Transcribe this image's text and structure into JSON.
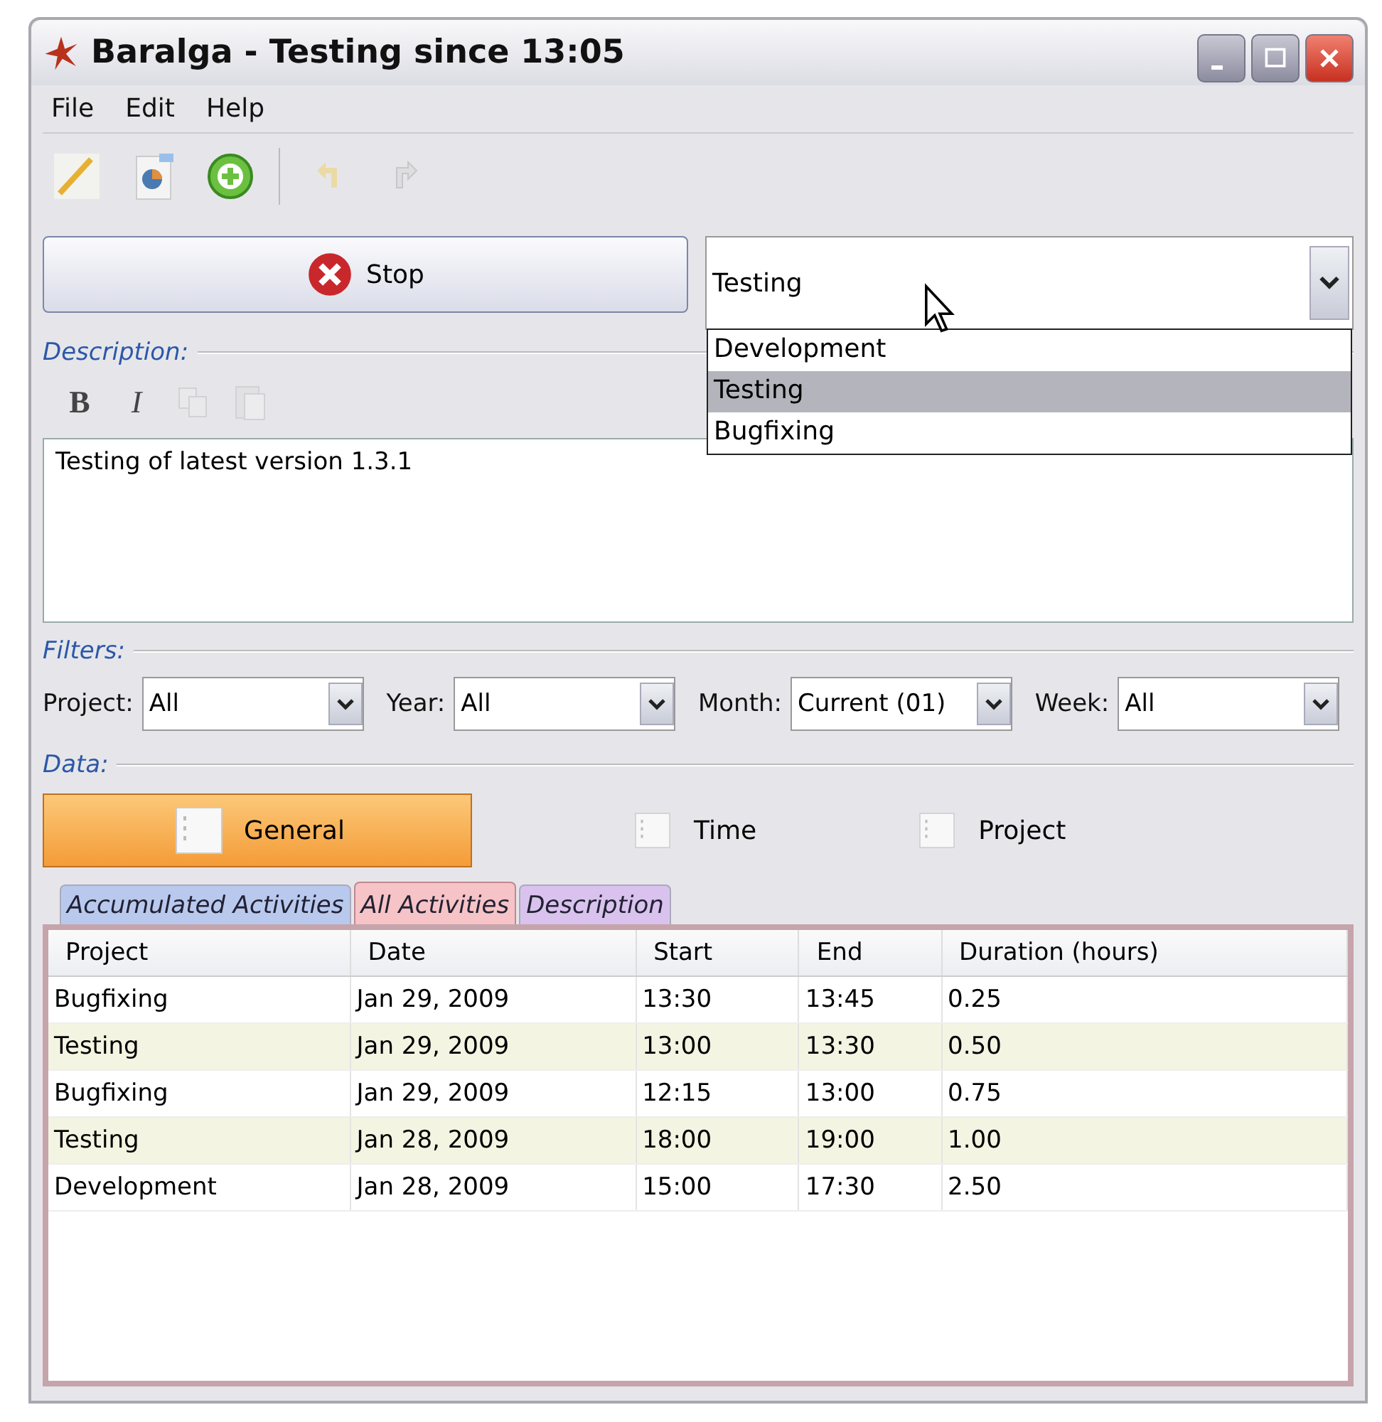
{
  "window": {
    "title": "Baralga - Testing since 13:05"
  },
  "menu": [
    "File",
    "Edit",
    "Help"
  ],
  "toolbar": [
    {
      "kind": "pencil",
      "disabled": false
    },
    {
      "kind": "report",
      "disabled": false
    },
    {
      "kind": "add",
      "disabled": false
    },
    {
      "kind": "undo",
      "disabled": true
    },
    {
      "kind": "redo",
      "disabled": true
    }
  ],
  "stop_button": {
    "label": "Stop"
  },
  "project_select": {
    "value": "Testing",
    "options": [
      {
        "label": "Development",
        "selected": false
      },
      {
        "label": "Testing",
        "selected": true
      },
      {
        "label": "Bugfixing",
        "selected": false
      }
    ]
  },
  "description": {
    "label": "Description:",
    "format_buttons": [
      {
        "kind": "bold",
        "label": "B",
        "disabled": false
      },
      {
        "kind": "italic",
        "label": "I",
        "disabled": false
      },
      {
        "kind": "copy",
        "disabled": true
      },
      {
        "kind": "paste",
        "disabled": true
      }
    ],
    "text": "Testing of latest version 1.3.1"
  },
  "filters": {
    "label": "Filters:",
    "fields": [
      {
        "label": "Project:",
        "value": "All"
      },
      {
        "label": "Year:",
        "value": "All"
      },
      {
        "label": "Month:",
        "value": "Current (01)"
      },
      {
        "label": "Week:",
        "value": "All"
      }
    ]
  },
  "data": {
    "label": "Data:",
    "views": [
      {
        "label": "General",
        "selected": true
      },
      {
        "label": "Time",
        "selected": false
      },
      {
        "label": "Project",
        "selected": false
      }
    ],
    "tabs": [
      {
        "label": "Accumulated Activities",
        "selected": false,
        "color": "#b9c9ee"
      },
      {
        "label": "All Activities",
        "selected": true,
        "color": "#f6c3c7"
      },
      {
        "label": "Description",
        "selected": false,
        "color": "#d9c3ee"
      }
    ],
    "table": {
      "columns": [
        "Project",
        "Date",
        "Start",
        "End",
        "Duration (hours)"
      ],
      "rows": [
        [
          "Bugfixing",
          "Jan 29, 2009",
          "13:30",
          "13:45",
          "0.25"
        ],
        [
          "Testing",
          "Jan 29, 2009",
          "13:00",
          "13:30",
          "0.50"
        ],
        [
          "Bugfixing",
          "Jan 29, 2009",
          "12:15",
          "13:00",
          "0.75"
        ],
        [
          "Testing",
          "Jan 28, 2009",
          "18:00",
          "19:00",
          "1.00"
        ],
        [
          "Development",
          "Jan 28, 2009",
          "15:00",
          "17:30",
          "2.50"
        ]
      ]
    }
  }
}
